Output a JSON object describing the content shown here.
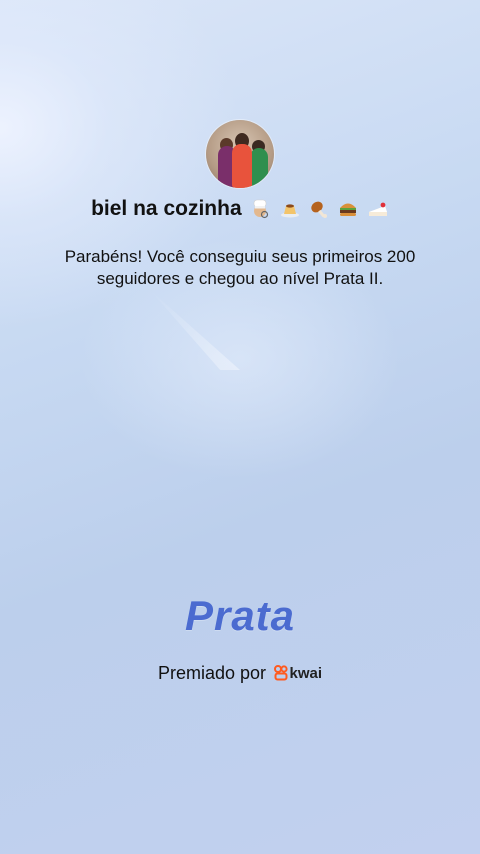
{
  "profile": {
    "username": "biel na cozinha",
    "emojis": [
      "chef-icon",
      "flan-icon",
      "drumstick-icon",
      "burger-icon",
      "cake-icon"
    ]
  },
  "message": "Parabéns! Você conseguiu seus primeiros 200 seguidores e chegou ao nível Prata II.",
  "level": {
    "name": "Prata",
    "color": "#4b6bd0"
  },
  "awarded_by": {
    "label": "Premiado por",
    "brand": "kwai",
    "brand_color": "#ff5a1f"
  }
}
